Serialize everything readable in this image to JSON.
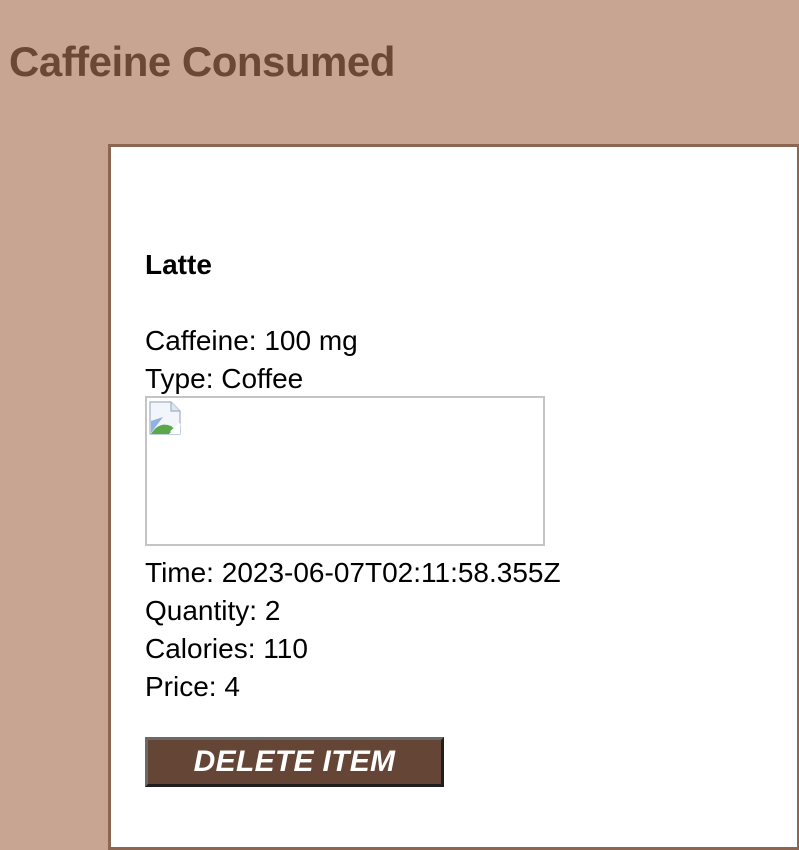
{
  "page": {
    "title": "Caffeine Consumed"
  },
  "item": {
    "name": "Latte",
    "caffeine_label": "Caffeine:",
    "caffeine_value": "100 mg",
    "type_label": "Type:",
    "type_value": "Coffee",
    "image_icon": "broken-image-icon",
    "time_label": "Time:",
    "time_value": "2023-06-07T02:11:58.355Z",
    "quantity_label": "Quantity:",
    "quantity_value": "2",
    "calories_label": "Calories:",
    "calories_value": "110",
    "price_label": "Price:",
    "price_value": "4",
    "delete_label": "DELETE ITEM"
  },
  "colors": {
    "background": "#c8a593",
    "title": "#6a4836",
    "card_border": "#8c6650",
    "button": "#644536"
  }
}
